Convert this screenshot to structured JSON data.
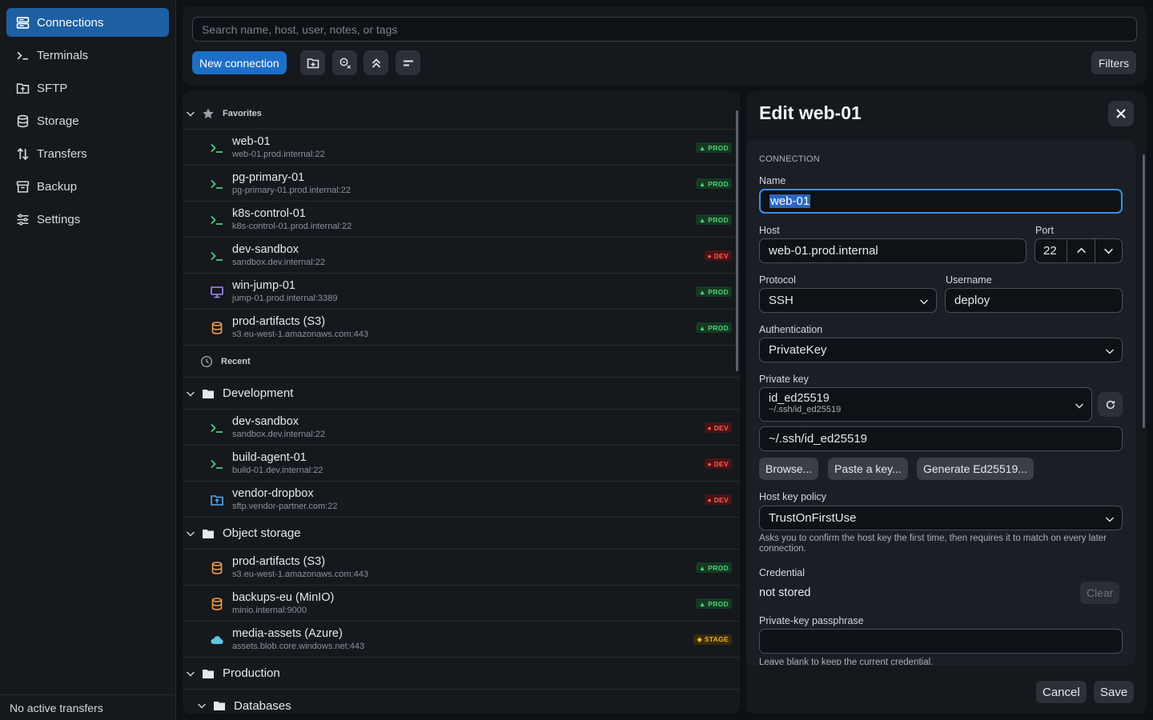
{
  "sidebar": {
    "items": [
      {
        "label": "Connections",
        "icon": "connections-icon"
      },
      {
        "label": "Terminals",
        "icon": "terminal-icon"
      },
      {
        "label": "SFTP",
        "icon": "sftp-folder-icon"
      },
      {
        "label": "Storage",
        "icon": "database-icon"
      },
      {
        "label": "Transfers",
        "icon": "transfer-arrows-icon"
      },
      {
        "label": "Backup",
        "icon": "archive-icon"
      },
      {
        "label": "Settings",
        "icon": "sliders-icon"
      }
    ],
    "footer": "No active transfers"
  },
  "toolbar": {
    "search_placeholder": "Search name, host, user, notes, or tags",
    "new_connection": "New connection",
    "filters": "Filters"
  },
  "list": {
    "favorites_label": "Favorites",
    "recent_label": "Recent",
    "favorites": [
      {
        "name": "web-01",
        "host": "web-01.prod.internal:22",
        "badge": "▲ PROD",
        "kind": "ssh"
      },
      {
        "name": "pg-primary-01",
        "host": "pg-primary-01.prod.internal:22",
        "badge": "▲ PROD",
        "kind": "ssh"
      },
      {
        "name": "k8s-control-01",
        "host": "k8s-control-01.prod.internal:22",
        "badge": "▲ PROD",
        "kind": "ssh"
      },
      {
        "name": "dev-sandbox",
        "host": "sandbox.dev.internal:22",
        "badge": "● DEV",
        "kind": "ssh"
      },
      {
        "name": "win-jump-01",
        "host": "jump-01.prod.internal:3389",
        "badge": "▲ PROD",
        "kind": "rdp"
      },
      {
        "name": "prod-artifacts (S3)",
        "host": "s3.eu-west-1.amazonaws.com:443",
        "badge": "▲ PROD",
        "kind": "bucket"
      }
    ],
    "groups": [
      {
        "label": "Development",
        "items": [
          {
            "name": "dev-sandbox",
            "host": "sandbox.dev.internal:22",
            "badge": "● DEV",
            "kind": "ssh"
          },
          {
            "name": "build-agent-01",
            "host": "build-01.dev.internal:22",
            "badge": "● DEV",
            "kind": "ssh"
          },
          {
            "name": "vendor-dropbox",
            "host": "sftp.vendor-partner.com:22",
            "badge": "● DEV",
            "kind": "sftp"
          }
        ]
      },
      {
        "label": "Object storage",
        "items": [
          {
            "name": "prod-artifacts (S3)",
            "host": "s3.eu-west-1.amazonaws.com:443",
            "badge": "▲ PROD",
            "kind": "bucket"
          },
          {
            "name": "backups-eu (MinIO)",
            "host": "minio.internal:9000",
            "badge": "▲ PROD",
            "kind": "bucket"
          },
          {
            "name": "media-assets (Azure)",
            "host": "assets.blob.core.windows.net:443",
            "badge": "◆ STAGE",
            "kind": "cloud"
          }
        ]
      },
      {
        "label": "Production",
        "items": []
      }
    ],
    "subgroup": "Databases"
  },
  "edit": {
    "title": "Edit web-01",
    "section": "CONNECTION",
    "name_label": "Name",
    "name_value": "web-01",
    "host_label": "Host",
    "host_value": "web-01.prod.internal",
    "port_label": "Port",
    "port_value": "22",
    "protocol_label": "Protocol",
    "protocol_value": "SSH",
    "username_label": "Username",
    "username_value": "deploy",
    "auth_label": "Authentication",
    "auth_value": "PrivateKey",
    "key_label": "Private key",
    "key_name": "id_ed25519",
    "key_path": "~/.ssh/id_ed25519",
    "key_path_value": "~/.ssh/id_ed25519",
    "browse": "Browse...",
    "paste": "Paste a key...",
    "generate": "Generate Ed25519...",
    "hostkey_label": "Host key policy",
    "hostkey_value": "TrustOnFirstUse",
    "hostkey_help": "Asks you to confirm the host key the first time, then requires it to match on every later connection.",
    "credential_label": "Credential",
    "credential_value": "not stored",
    "clear": "Clear",
    "passphrase_label": "Private-key passphrase",
    "passphrase_help": "Leave blank to keep the current credential.",
    "cancel": "Cancel",
    "save": "Save"
  },
  "colors": {
    "accent": "#1d6fc6",
    "prod": "#4fd07a",
    "dev": "#ff5c5c",
    "stage": "#f0b429"
  }
}
